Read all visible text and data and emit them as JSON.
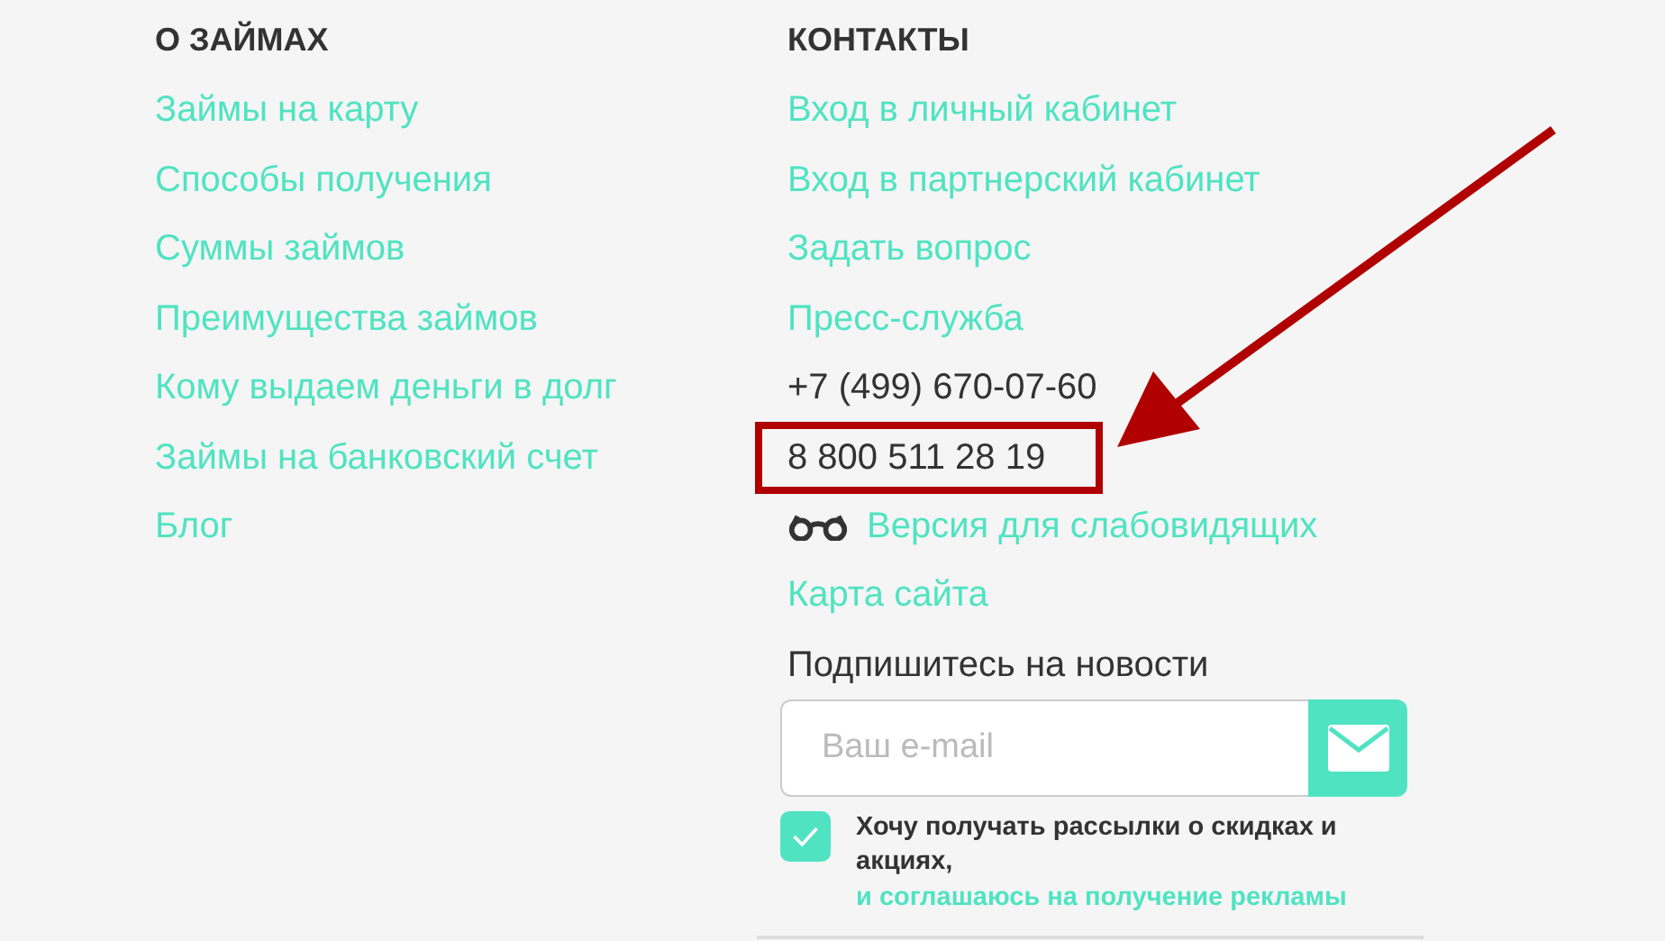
{
  "about": {
    "heading": "О ЗАЙМАХ",
    "links": [
      "Займы на карту",
      "Способы получения",
      "Суммы займов",
      "Преимущества займов",
      "Кому выдаем деньги в долг",
      "Займы на банковский счет",
      "Блог"
    ]
  },
  "contacts": {
    "heading": "КОНТАКТЫ",
    "items": [
      {
        "kind": "link",
        "text": "Вход в личный кабинет"
      },
      {
        "kind": "link",
        "text": "Вход в партнерский кабинет"
      },
      {
        "kind": "link",
        "text": "Задать вопрос"
      },
      {
        "kind": "link",
        "text": "Пресс-служба"
      },
      {
        "kind": "phone",
        "text": "+7 (499) 670-07-60"
      },
      {
        "kind": "phone",
        "text": "8 800 511 28 19",
        "highlighted": true
      },
      {
        "kind": "glasses-link",
        "text": "Версия для слабовидящих"
      },
      {
        "kind": "link",
        "text": "Карта сайта"
      }
    ]
  },
  "subscribe": {
    "title": "Подпишитесь на новости",
    "placeholder": "Ваш e-mail",
    "consent_checked": true,
    "consent_text": "Хочу получать рассылки о скидках и акциях,",
    "consent_link": "и соглашаюсь на получение рекламы"
  }
}
